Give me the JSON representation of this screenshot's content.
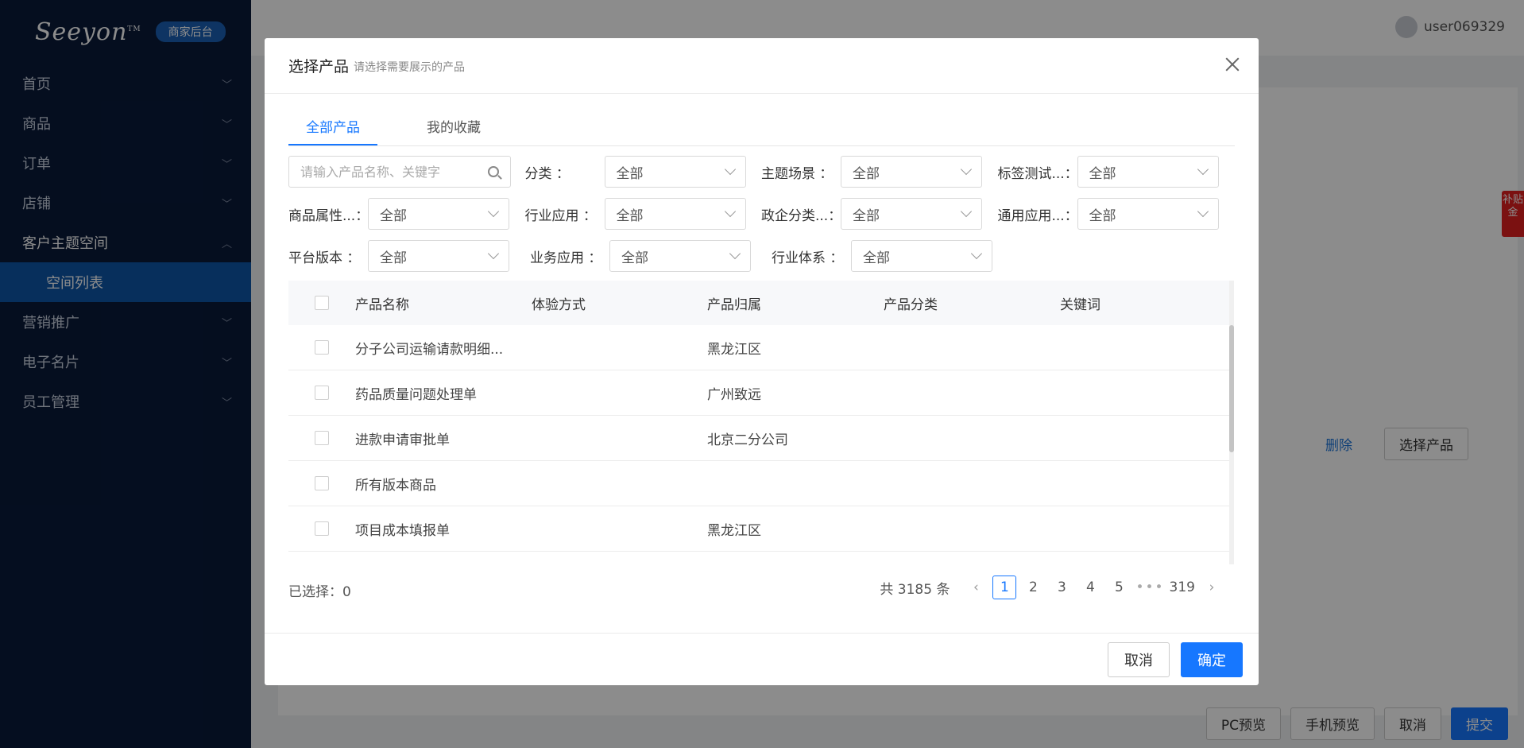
{
  "sidebar": {
    "logo": "Seeyon",
    "badge": "商家后台",
    "items": [
      {
        "label": "首页"
      },
      {
        "label": "商品"
      },
      {
        "label": "订单"
      },
      {
        "label": "店铺"
      },
      {
        "label": "客户主题空间"
      },
      {
        "label": "空间列表"
      },
      {
        "label": "营销推广"
      },
      {
        "label": "电子名片"
      },
      {
        "label": "员工管理"
      }
    ]
  },
  "topbar": {
    "username": "user069329"
  },
  "background": {
    "delete_label": "删除",
    "select_product_label": "选择产品",
    "side_tag": "补贴金",
    "bottom_buttons": [
      "PC预览",
      "手机预览",
      "取消",
      "提交"
    ]
  },
  "modal": {
    "title": "选择产品",
    "subtitle": "请选择需要展示的产品",
    "tabs": [
      "全部产品",
      "我的收藏"
    ],
    "search_placeholder": "请输入产品名称、关键字",
    "filters": [
      {
        "label": "分类",
        "value": "全部"
      },
      {
        "label": "主题场景",
        "value": "全部"
      },
      {
        "label": "标签测试...",
        "value": "全部"
      },
      {
        "label": "商品属性...",
        "value": "全部"
      },
      {
        "label": "行业应用",
        "value": "全部"
      },
      {
        "label": "政企分类...",
        "value": "全部"
      },
      {
        "label": "通用应用...",
        "value": "全部"
      },
      {
        "label": "平台版本",
        "value": "全部"
      },
      {
        "label": "业务应用",
        "value": "全部"
      },
      {
        "label": "行业体系",
        "value": "全部"
      }
    ],
    "columns": [
      "产品名称",
      "体验方式",
      "产品归属",
      "产品分类",
      "关键词"
    ],
    "rows": [
      {
        "name": "分子公司运输请款明细...",
        "mode": "",
        "owner": "黑龙江区",
        "category": "",
        "keyword": ""
      },
      {
        "name": "药品质量问题处理单",
        "mode": "",
        "owner": "广州致远",
        "category": "",
        "keyword": ""
      },
      {
        "name": "进款申请审批单",
        "mode": "",
        "owner": "北京二分公司",
        "category": "",
        "keyword": ""
      },
      {
        "name": "所有版本商品",
        "mode": "",
        "owner": "",
        "category": "",
        "keyword": ""
      },
      {
        "name": "项目成本填报单",
        "mode": "",
        "owner": "黑龙江区",
        "category": "",
        "keyword": ""
      }
    ],
    "selected_label": "已选择：0",
    "pager": {
      "total": "共 3185 条",
      "pages": [
        "1",
        "2",
        "3",
        "4",
        "5"
      ],
      "ellipsis": "•••",
      "last": "319"
    },
    "cancel_label": "取消",
    "ok_label": "确定"
  }
}
